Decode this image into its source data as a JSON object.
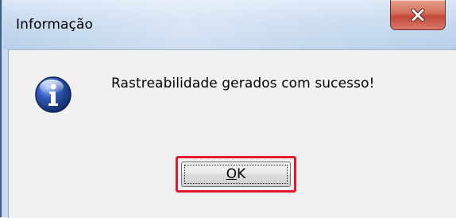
{
  "dialog": {
    "title": "Informação",
    "message": "Rastreabilidade gerados com sucesso!",
    "ok_mnemonic": "O",
    "ok_rest": "K",
    "icons": {
      "status": "info-icon",
      "close": "close-icon"
    }
  },
  "colors": {
    "highlight": "#e31b2f",
    "close_button": "#c2473a",
    "info_icon": "#2f57b8"
  }
}
